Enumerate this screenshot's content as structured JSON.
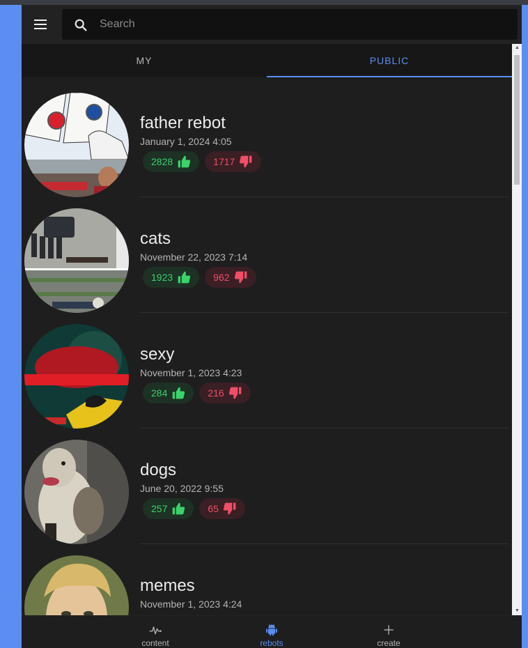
{
  "search": {
    "placeholder": "Search"
  },
  "tabs": [
    {
      "label": "MY",
      "active": false
    },
    {
      "label": "PUBLIC",
      "active": true
    }
  ],
  "items": [
    {
      "title": "father rebot",
      "date": "January 1, 2024 4:05",
      "upvotes": "2828",
      "downvotes": "1717"
    },
    {
      "title": "cats",
      "date": "November 22, 2023 7:14",
      "upvotes": "1923",
      "downvotes": "962"
    },
    {
      "title": "sexy",
      "date": "November 1, 2023 4:23",
      "upvotes": "284",
      "downvotes": "216"
    },
    {
      "title": "dogs",
      "date": "June 20, 2022 9:55",
      "upvotes": "257",
      "downvotes": "65"
    },
    {
      "title": "memes",
      "date": "November 1, 2023 4:24"
    }
  ],
  "bottom_nav": [
    {
      "label": "content",
      "icon": "pulse-icon",
      "active": false
    },
    {
      "label": "rebots",
      "icon": "android-icon",
      "active": true
    },
    {
      "label": "create",
      "icon": "plus-icon",
      "active": false
    }
  ],
  "colors": {
    "accent": "#5b8ef0",
    "upvote": "#3ad36b",
    "downvote": "#f04e66",
    "background": "#1e1e1e"
  }
}
